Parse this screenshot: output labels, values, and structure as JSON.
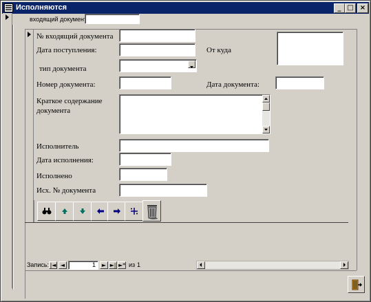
{
  "window": {
    "title": "Исполняются",
    "minimize_glyph": "_",
    "maximize_glyph": "□",
    "close_glyph": "×"
  },
  "header": {
    "incoming_label": "входящий документ",
    "incoming_value": ""
  },
  "form": {
    "incoming_no_label": "№ входящий документа",
    "incoming_no_value": "",
    "received_date_label": "Дата поступления:",
    "received_date_value": "",
    "from_label": "От куда",
    "from_value": "",
    "doc_type_label": "тип документа",
    "doc_type_value": "",
    "doc_number_label": "Номер документа:",
    "doc_number_value": "",
    "doc_date_label": "Дата документа:",
    "doc_date_value": "",
    "summary_label_line1": "Краткое содержание",
    "summary_label_line2": "документа",
    "summary_value": "",
    "executor_label": "Исполнитель",
    "executor_value": "",
    "exec_date_label": "Дата исполнения:",
    "exec_date_value": "",
    "executed_label": "Исполнено",
    "executed_value": "",
    "outgoing_no_label": "Исх. № документа",
    "outgoing_no_value": ""
  },
  "toolbar": {
    "buttons": [
      "find-icon",
      "first-record-icon",
      "last-record-icon",
      "previous-record-icon",
      "next-record-icon",
      "new-record-icon",
      "delete-icon"
    ]
  },
  "record_nav": {
    "label": "Запись:",
    "current": "1",
    "of_label": "из",
    "total": "1",
    "first_glyph": "|◄",
    "prev_glyph": "◄",
    "next_glyph": "►",
    "last_glyph": "►|",
    "new_glyph": "►*"
  },
  "colors": {
    "titlebar": "#0a246a",
    "face": "#d4d0c8",
    "field": "#ffffff",
    "arrow_green": "#007060",
    "arrow_blue": "#000080"
  }
}
